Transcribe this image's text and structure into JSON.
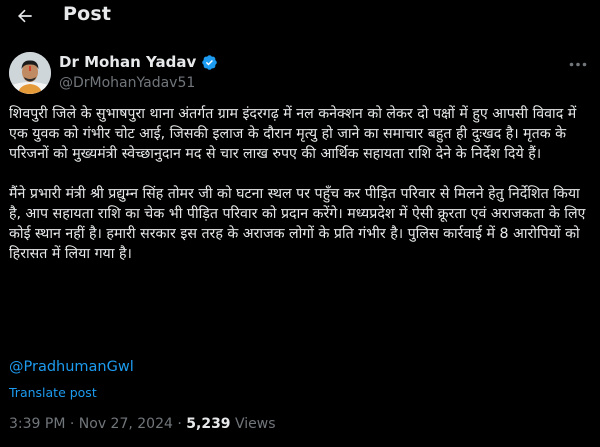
{
  "header": {
    "back_icon": "arrow-left-icon",
    "title": "Post"
  },
  "author": {
    "name": "Dr Mohan Yadav",
    "handle": "@DrMohanYadav51",
    "verified": true,
    "verified_color": "#1d9bf0"
  },
  "post": {
    "paragraphs": [
      "शिवपुरी जिले के सुभाषपुरा थाना अंतर्गत ग्राम इंदरगढ़ में नल कनेक्शन को लेकर दो पक्षों में हुए आपसी विवाद में एक युवक को गंभीर चोट आई, जिसकी इलाज के दौरान मृत्यु हो जाने का समाचार बहुत ही दुःखद है। मृतक के परिजनों को मुख्यमंत्री स्वेच्छानुदान मद से चार लाख रुपए की आर्थिक सहायता राशि देने के निर्देश दिये हैं।",
      "मैंने प्रभारी मंत्री श्री प्रद्युम्न सिंह तोमर जी को घटना स्थल पर पहुँच कर पीड़ित परिवार से मिलने हेतु निर्देशित किया है, आप सहायता राशि का चेक भी पीड़ित परिवार को प्रदान करेंगे। मध्यप्रदेश में ऐसी क्रूरता एवं अराजकता के लिए कोई स्थान नहीं है। हमारी सरकार इस तरह के अराजक लोगों के प्रति गंभीर है। पुलिस कार्रवाई में 8 आरोपियों को हिरासत में लिया गया है।"
    ],
    "mention": "@PradhumanGwl",
    "translate_label": "Translate post",
    "time": "3:39 PM",
    "separator": "·",
    "date": "Nov 27, 2024",
    "views_count": "5,239",
    "views_label": "Views"
  },
  "colors": {
    "background": "#000000",
    "text": "#e7e9ea",
    "secondary": "#71767b",
    "link": "#1d9bf0"
  }
}
